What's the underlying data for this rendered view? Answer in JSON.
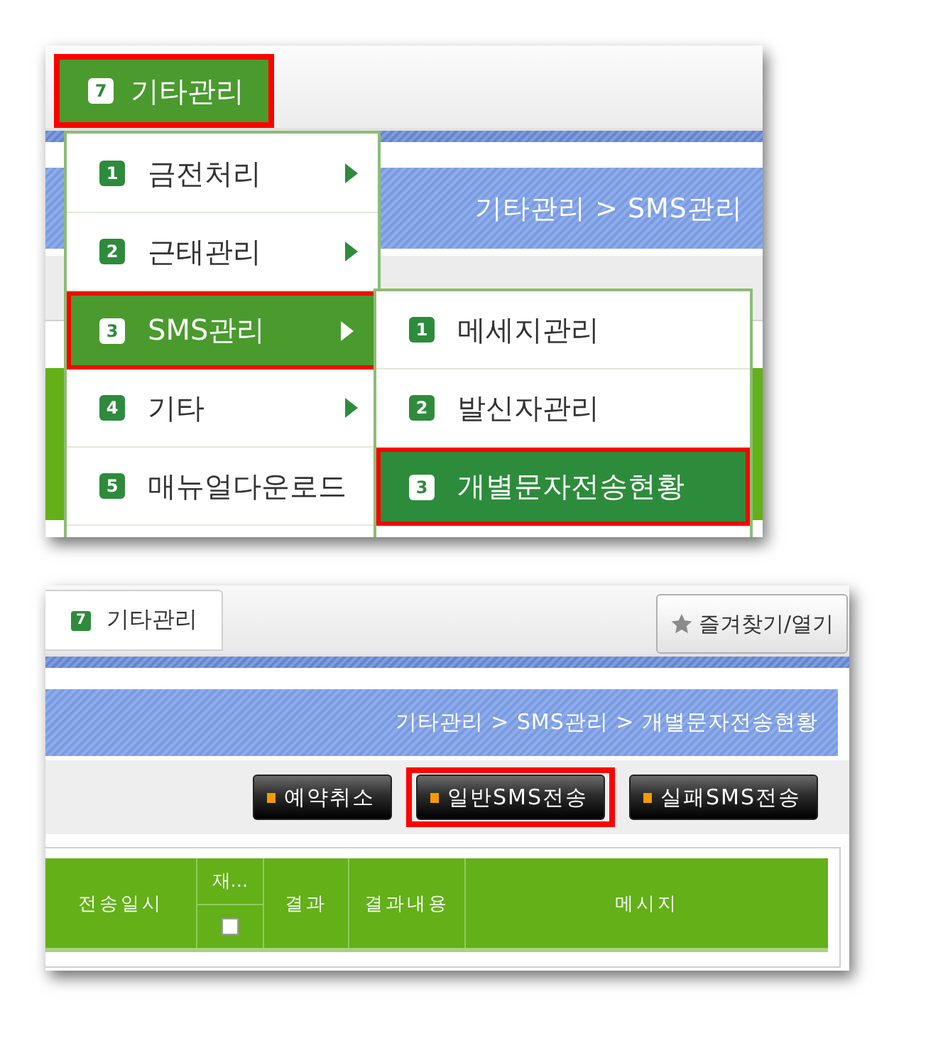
{
  "menu_panel": {
    "top_tab": {
      "number": "7",
      "label": "기타관리",
      "selected": true,
      "highlighted": true
    },
    "breadcrumb": "기타관리 > SMS관리",
    "menu": [
      {
        "number": "1",
        "label": "금전처리",
        "has_submenu": true,
        "selected": false,
        "highlighted": false
      },
      {
        "number": "2",
        "label": "근태관리",
        "has_submenu": true,
        "selected": false,
        "highlighted": false
      },
      {
        "number": "3",
        "label": "SMS관리",
        "has_submenu": true,
        "selected": true,
        "highlighted": true
      },
      {
        "number": "4",
        "label": "기타",
        "has_submenu": true,
        "selected": false,
        "highlighted": false
      },
      {
        "number": "5",
        "label": "매뉴얼다운로드",
        "has_submenu": false,
        "selected": false,
        "highlighted": false
      }
    ],
    "submenu": [
      {
        "number": "1",
        "label": "메세지관리",
        "selected": false,
        "highlighted": false
      },
      {
        "number": "2",
        "label": "발신자관리",
        "selected": false,
        "highlighted": false
      },
      {
        "number": "3",
        "label": "개별문자전송현황",
        "selected": true,
        "highlighted": true
      }
    ]
  },
  "page_panel": {
    "tab": {
      "number": "7",
      "label": "기타관리",
      "selected": false
    },
    "favorites_button": {
      "label": "즐겨찾기/열기"
    },
    "breadcrumb": "기타관리 > SMS관리 > 개별문자전송현황",
    "buttons": [
      {
        "label": "예약취소",
        "highlighted": false
      },
      {
        "label": "일반SMS전송",
        "highlighted": true
      },
      {
        "label": "실패SMS전송",
        "highlighted": false
      }
    ],
    "table": {
      "columns": [
        {
          "label": "전송일시"
        },
        {
          "label": "재...",
          "checkbox": {
            "checked": false
          }
        },
        {
          "label": "결과"
        },
        {
          "label": "결과내용"
        },
        {
          "label": "메시지"
        }
      ]
    }
  }
}
